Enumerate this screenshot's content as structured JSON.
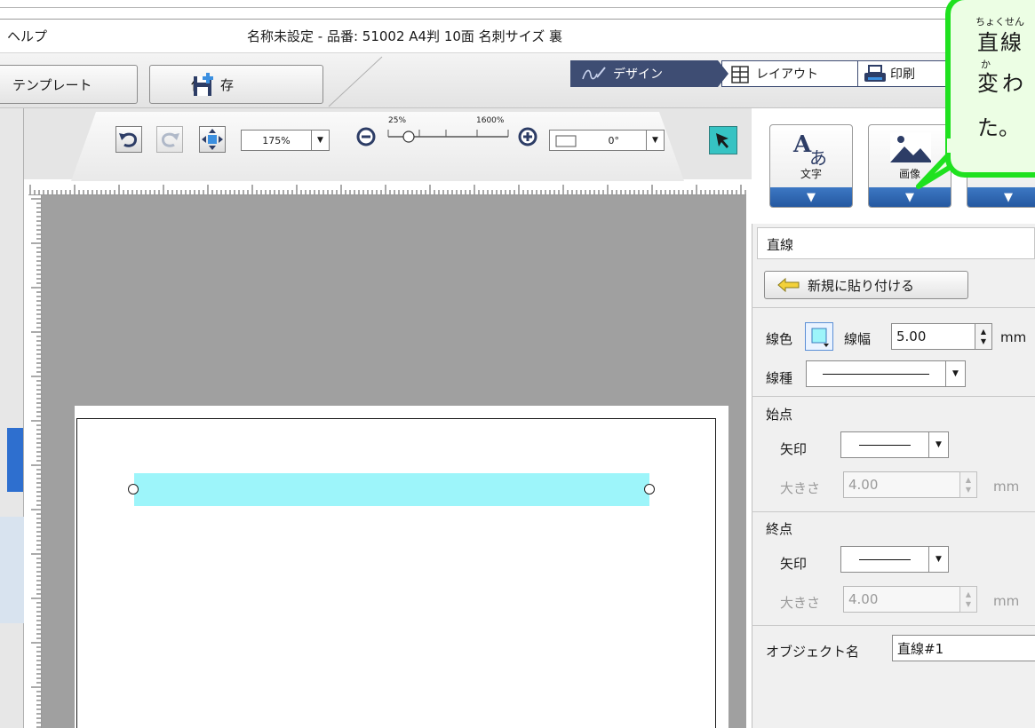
{
  "titlebar": {
    "menu_help": "ヘルプ",
    "window_title": "名称未設定  - 品番: 51002 A4判 10面 名刺サイズ 裏"
  },
  "ribbon": {
    "template_label": "テンプレート",
    "save_label": "保存",
    "tabs": [
      {
        "label": "デザイン",
        "active": true
      },
      {
        "label": "レイアウト",
        "active": false
      },
      {
        "label": "印刷",
        "active": false
      }
    ]
  },
  "toolbar": {
    "zoom_value": "175%",
    "zoom_min_label": "25%",
    "zoom_max_label": "1600%",
    "rotation_value": "0°"
  },
  "tools": {
    "text_label": "文字",
    "image_label": "画像"
  },
  "callout": {
    "ruby1": "ちょくせん",
    "line1": "直線",
    "ruby2": "か",
    "line2": "変わ",
    "line3": "た。"
  },
  "properties": {
    "title": "直線",
    "paste_new_label": "新規に貼り付ける",
    "line_color_label": "線色",
    "line_width_label": "線幅",
    "line_width_value": "5.00",
    "line_width_unit": "mm",
    "line_type_label": "線種",
    "start_point_label": "始点",
    "start_arrow_label": "矢印",
    "start_size_label": "大きさ",
    "start_size_value": "4.00",
    "start_size_unit": "mm",
    "end_point_label": "終点",
    "end_arrow_label": "矢印",
    "end_size_label": "大きさ",
    "end_size_value": "4.00",
    "end_size_unit": "mm",
    "object_name_label": "オブジェクト名",
    "object_name_value": "直線#1"
  },
  "colors": {
    "line_object_fill": "#9df5fa",
    "callout_border": "#1fe11f",
    "design_tab": "#3e4d73",
    "select_tool": "#36c3c3"
  }
}
